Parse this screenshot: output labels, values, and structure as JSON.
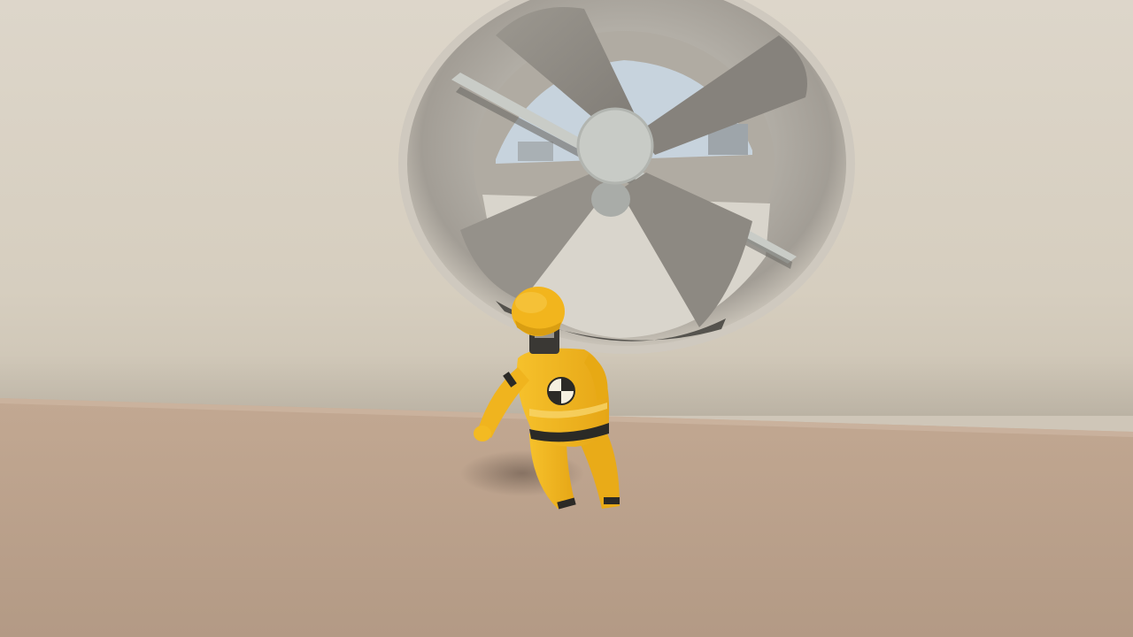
{
  "scene": {
    "colors": {
      "wall": "#d8d0c3",
      "floor": "#b89f8a",
      "fan_duct": "#9a958d",
      "fan_blade": "#8f8b84",
      "fan_hub": "#c9ccc8",
      "sky": "#c6d2dc",
      "character_suit": "#f1b41c",
      "character_stripe": "#2b2a26"
    },
    "objects": {
      "fan": "industrial-fan",
      "character": "crash-test-dummy",
      "chest_mark": "crash-test-symbol"
    }
  }
}
